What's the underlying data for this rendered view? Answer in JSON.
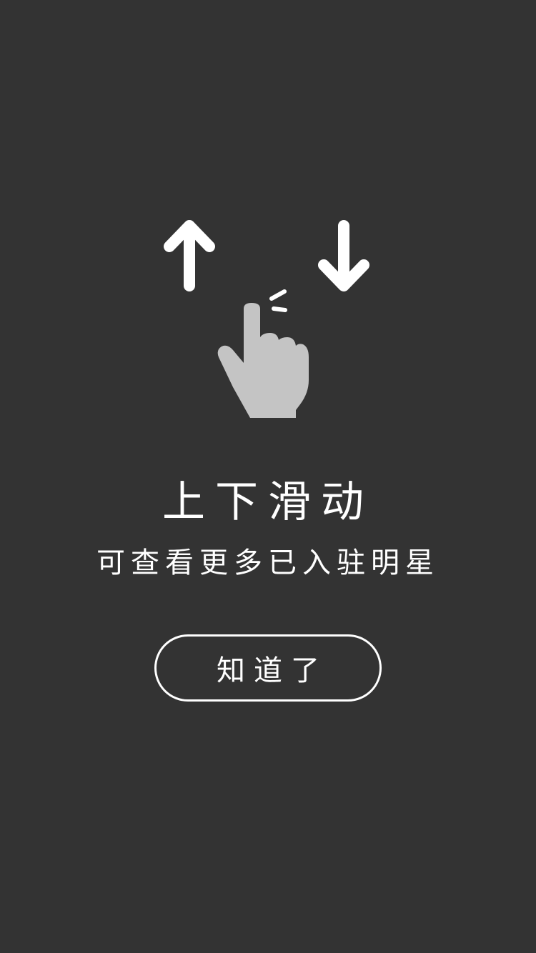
{
  "guide": {
    "title": "上下滑动",
    "subtitle": "可查看更多已入驻明星",
    "confirm_label": "知道了"
  },
  "icons": {
    "up": "arrow-up-icon",
    "down": "arrow-down-icon",
    "hand": "swipe-hand-icon"
  },
  "colors": {
    "background": "#333333",
    "foreground": "#ffffff",
    "hand": "#c4c4c4"
  }
}
